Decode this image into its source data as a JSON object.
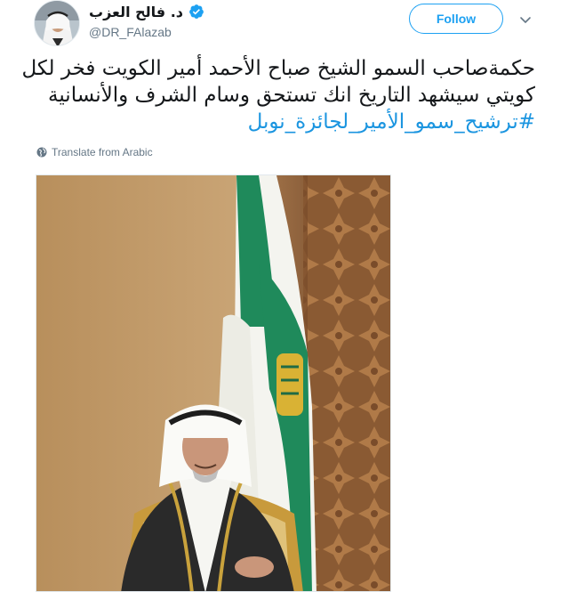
{
  "author": {
    "display_name": "د. فالح العزب",
    "handle": "@DR_FAlazab",
    "verified": true,
    "avatar_icon": "user-avatar"
  },
  "actions": {
    "follow_label": "Follow",
    "more_icon": "chevron-down-icon"
  },
  "tweet": {
    "lines": [
      "حكمةصاحب السمو الشيخ صباح الأحمد أمير الكويت فخر لكل",
      "كويتي سيشهد التاريخ انك تستحق وسام الشرف والأنسانية"
    ],
    "hashtag": "#ترشيح_سمو_الأمير_لجائزة_نوبل",
    "translate_label": "Translate from Arabic"
  },
  "colors": {
    "accent": "#1da1f2",
    "hashtag": "#1b95e0",
    "muted": "#657786",
    "flag_green": "#1f8a5b",
    "flag_white": "#f4f4ef",
    "flag_emblem": "#d9b234"
  }
}
